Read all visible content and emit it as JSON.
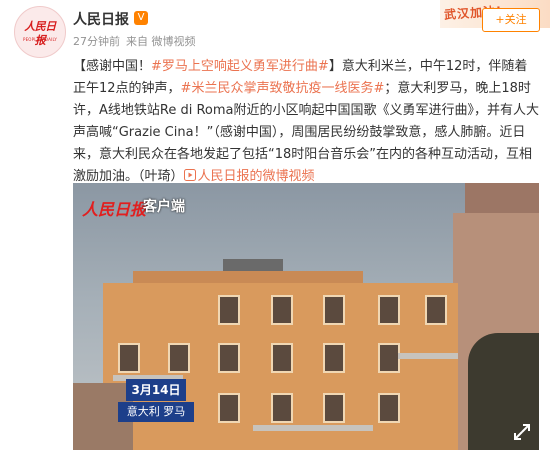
{
  "header": {
    "account_name": "人民日报",
    "verified_badge": "V",
    "time": "27分钟前",
    "source": "来自 微博视频",
    "follow_label": "+关注",
    "banner_text": "武汉加油!",
    "avatar_seal_text": "人民日报",
    "avatar_sub_text": "PEOPLE'S DAILY"
  },
  "post": {
    "prefix": "【感谢中国！",
    "tag1": "#罗马上空响起义勇军进行曲#",
    "part1": "】意大利米兰，中午12时，伴随着正午12点的钟声，",
    "tag2": "#米兰民众掌声致敬抗疫一线医务#",
    "part2": "；意大利罗马，晚上18时许，A线地铁站Re di Roma附近的小区响起中国国歌《义勇军进行曲》，并有人大声高喊“Grazie Cina！”（感谢中国），周围居民纷纷鼓掌致意，感人肺腑。近日来，意大利民众在各地发起了包括“18时阳台音乐会”在内的各种互动活动，互相激励加油。（叶琦）",
    "link_text": "人民日报的微博视频"
  },
  "video": {
    "logo_text": "人民日报",
    "client_label": "客户端",
    "date_label": "3月14日",
    "location_label": "意大利 罗马",
    "expand_icon": "expand-icon"
  },
  "colors": {
    "accent_orange": "#ff8200",
    "tag_color": "#eb7350",
    "badge_blue": "#1d3f8a",
    "logo_red": "#e11f1f"
  }
}
